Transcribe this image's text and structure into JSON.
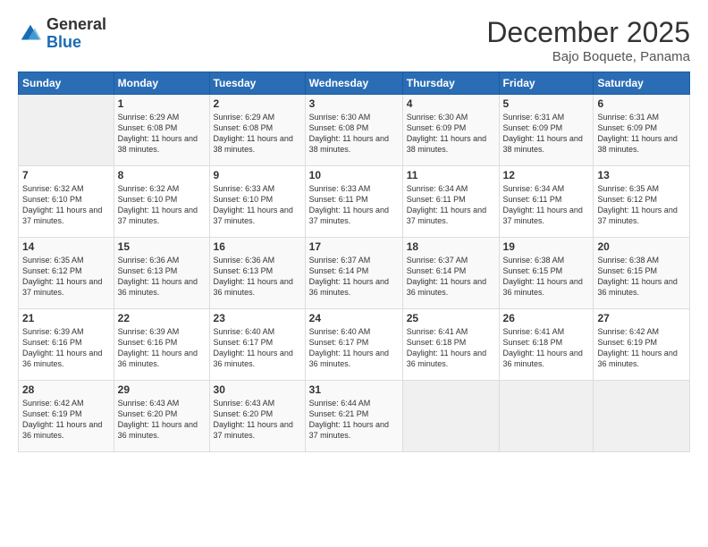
{
  "logo": {
    "general": "General",
    "blue": "Blue"
  },
  "title": {
    "month_year": "December 2025",
    "location": "Bajo Boquete, Panama"
  },
  "calendar": {
    "headers": [
      "Sunday",
      "Monday",
      "Tuesday",
      "Wednesday",
      "Thursday",
      "Friday",
      "Saturday"
    ],
    "weeks": [
      [
        {
          "day": "",
          "empty": true
        },
        {
          "day": "1",
          "rise": "6:29 AM",
          "set": "6:08 PM",
          "daylight": "11 hours and 38 minutes."
        },
        {
          "day": "2",
          "rise": "6:29 AM",
          "set": "6:08 PM",
          "daylight": "11 hours and 38 minutes."
        },
        {
          "day": "3",
          "rise": "6:30 AM",
          "set": "6:08 PM",
          "daylight": "11 hours and 38 minutes."
        },
        {
          "day": "4",
          "rise": "6:30 AM",
          "set": "6:09 PM",
          "daylight": "11 hours and 38 minutes."
        },
        {
          "day": "5",
          "rise": "6:31 AM",
          "set": "6:09 PM",
          "daylight": "11 hours and 38 minutes."
        },
        {
          "day": "6",
          "rise": "6:31 AM",
          "set": "6:09 PM",
          "daylight": "11 hours and 38 minutes."
        }
      ],
      [
        {
          "day": "7",
          "rise": "6:32 AM",
          "set": "6:10 PM",
          "daylight": "11 hours and 37 minutes."
        },
        {
          "day": "8",
          "rise": "6:32 AM",
          "set": "6:10 PM",
          "daylight": "11 hours and 37 minutes."
        },
        {
          "day": "9",
          "rise": "6:33 AM",
          "set": "6:10 PM",
          "daylight": "11 hours and 37 minutes."
        },
        {
          "day": "10",
          "rise": "6:33 AM",
          "set": "6:11 PM",
          "daylight": "11 hours and 37 minutes."
        },
        {
          "day": "11",
          "rise": "6:34 AM",
          "set": "6:11 PM",
          "daylight": "11 hours and 37 minutes."
        },
        {
          "day": "12",
          "rise": "6:34 AM",
          "set": "6:11 PM",
          "daylight": "11 hours and 37 minutes."
        },
        {
          "day": "13",
          "rise": "6:35 AM",
          "set": "6:12 PM",
          "daylight": "11 hours and 37 minutes."
        }
      ],
      [
        {
          "day": "14",
          "rise": "6:35 AM",
          "set": "6:12 PM",
          "daylight": "11 hours and 37 minutes."
        },
        {
          "day": "15",
          "rise": "6:36 AM",
          "set": "6:13 PM",
          "daylight": "11 hours and 36 minutes."
        },
        {
          "day": "16",
          "rise": "6:36 AM",
          "set": "6:13 PM",
          "daylight": "11 hours and 36 minutes."
        },
        {
          "day": "17",
          "rise": "6:37 AM",
          "set": "6:14 PM",
          "daylight": "11 hours and 36 minutes."
        },
        {
          "day": "18",
          "rise": "6:37 AM",
          "set": "6:14 PM",
          "daylight": "11 hours and 36 minutes."
        },
        {
          "day": "19",
          "rise": "6:38 AM",
          "set": "6:15 PM",
          "daylight": "11 hours and 36 minutes."
        },
        {
          "day": "20",
          "rise": "6:38 AM",
          "set": "6:15 PM",
          "daylight": "11 hours and 36 minutes."
        }
      ],
      [
        {
          "day": "21",
          "rise": "6:39 AM",
          "set": "6:16 PM",
          "daylight": "11 hours and 36 minutes."
        },
        {
          "day": "22",
          "rise": "6:39 AM",
          "set": "6:16 PM",
          "daylight": "11 hours and 36 minutes."
        },
        {
          "day": "23",
          "rise": "6:40 AM",
          "set": "6:17 PM",
          "daylight": "11 hours and 36 minutes."
        },
        {
          "day": "24",
          "rise": "6:40 AM",
          "set": "6:17 PM",
          "daylight": "11 hours and 36 minutes."
        },
        {
          "day": "25",
          "rise": "6:41 AM",
          "set": "6:18 PM",
          "daylight": "11 hours and 36 minutes."
        },
        {
          "day": "26",
          "rise": "6:41 AM",
          "set": "6:18 PM",
          "daylight": "11 hours and 36 minutes."
        },
        {
          "day": "27",
          "rise": "6:42 AM",
          "set": "6:19 PM",
          "daylight": "11 hours and 36 minutes."
        }
      ],
      [
        {
          "day": "28",
          "rise": "6:42 AM",
          "set": "6:19 PM",
          "daylight": "11 hours and 36 minutes."
        },
        {
          "day": "29",
          "rise": "6:43 AM",
          "set": "6:20 PM",
          "daylight": "11 hours and 36 minutes."
        },
        {
          "day": "30",
          "rise": "6:43 AM",
          "set": "6:20 PM",
          "daylight": "11 hours and 37 minutes."
        },
        {
          "day": "31",
          "rise": "6:44 AM",
          "set": "6:21 PM",
          "daylight": "11 hours and 37 minutes."
        },
        {
          "day": "",
          "empty": true
        },
        {
          "day": "",
          "empty": true
        },
        {
          "day": "",
          "empty": true
        }
      ]
    ]
  }
}
